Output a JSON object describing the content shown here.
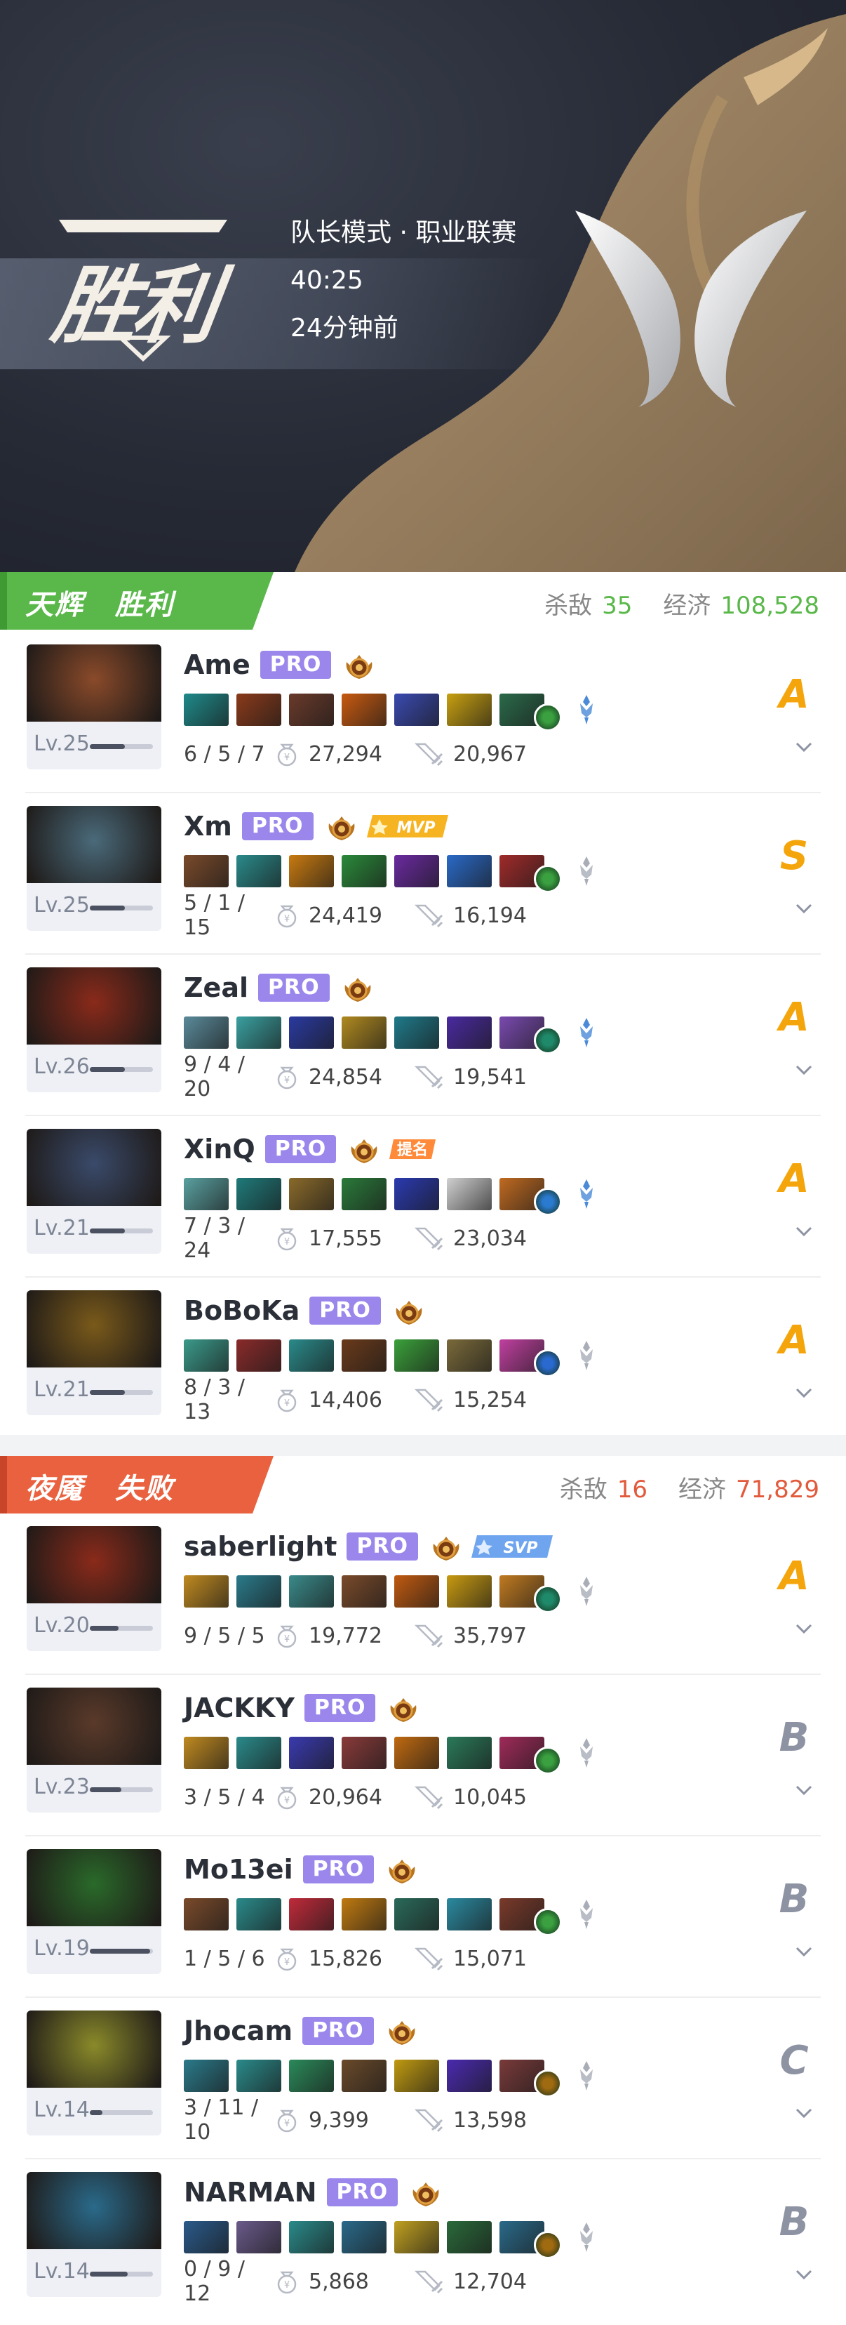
{
  "match": {
    "result": "胜利",
    "mode": "队长模式 · 职业联赛",
    "duration": "40:25",
    "time_ago": "24分钟前"
  },
  "teams": [
    {
      "side": "天辉",
      "result": "胜利",
      "kills_label": "杀敌",
      "kills": "35",
      "econ_label": "经济",
      "economy": "108,528",
      "color": "#5ab84a",
      "players": [
        {
          "name": "Ame",
          "pro": "PRO",
          "level": "Lv.25",
          "level_fill": 0.55,
          "kda": "6 / 5 / 7",
          "gold": "27,294",
          "damage": "20,967",
          "grade": "A",
          "badge": "",
          "hero_color": "#8a4a2a",
          "items": [
            "#1f8a8a",
            "#8a3a1a",
            "#6a3a2a",
            "#c85a10",
            "#3a4ab0",
            "#c8a010",
            "#2a6a4a"
          ],
          "neutral": "#3aa040"
        },
        {
          "name": "Xm",
          "pro": "PRO",
          "level": "Lv.25",
          "level_fill": 0.55,
          "kda": "5 / 1 / 15",
          "gold": "24,419",
          "damage": "16,194",
          "grade": "S",
          "badge": "MVP",
          "hero_color": "#4a6a7a",
          "items": [
            "#7a4a2a",
            "#2a8a8a",
            "#c87a10",
            "#2a8a3a",
            "#6a2aa0",
            "#2a6ac8",
            "#a02a2a"
          ],
          "neutral": "#3aa040"
        },
        {
          "name": "Zeal",
          "pro": "PRO",
          "level": "Lv.26",
          "level_fill": 0.55,
          "kda": "9 / 4 / 20",
          "gold": "24,854",
          "damage": "19,541",
          "grade": "A",
          "badge": "",
          "hero_color": "#8a2a1a",
          "items": [
            "#5a8a9a",
            "#3aa0a0",
            "#2a3aa0",
            "#b08a20",
            "#1f7a8a",
            "#4a2aa0",
            "#7a4ab0"
          ],
          "neutral": "#1f8a6a"
        },
        {
          "name": "XinQ",
          "pro": "PRO",
          "level": "Lv.21",
          "level_fill": 0.55,
          "kda": "7 / 3 / 24",
          "gold": "17,555",
          "damage": "23,034",
          "grade": "A",
          "badge": "提名",
          "hero_color": "#3a4a6a",
          "items": [
            "#5aa0a0",
            "#1f7a7a",
            "#8a6a2a",
            "#2a7a3a",
            "#2a3ab0",
            "#d0d0d0",
            "#c06a20"
          ],
          "neutral": "#2a7ad0"
        },
        {
          "name": "BoBoKa",
          "pro": "PRO",
          "level": "Lv.21",
          "level_fill": 0.55,
          "kda": "8 / 3 / 13",
          "gold": "14,406",
          "damage": "15,254",
          "grade": "A",
          "badge": "",
          "hero_color": "#7a5a1a",
          "items": [
            "#3a9a8a",
            "#8a2a2a",
            "#2a8a8a",
            "#6a3a1a",
            "#3aa03a",
            "#7a6a3a",
            "#c040a0"
          ],
          "neutral": "#2a6ad0"
        }
      ]
    },
    {
      "side": "夜魇",
      "result": "失败",
      "kills_label": "杀敌",
      "kills": "16",
      "econ_label": "经济",
      "economy": "71,829",
      "color": "#e25a3c",
      "players": [
        {
          "name": "saberlight",
          "pro": "PRO",
          "level": "Lv.20",
          "level_fill": 0.45,
          "kda": "9 / 5 / 5",
          "gold": "19,772",
          "damage": "35,797",
          "grade": "A",
          "badge": "SVP",
          "hero_color": "#8a2a1a",
          "items": [
            "#c08a20",
            "#2a7a8a",
            "#3a8a8a",
            "#7a4a2a",
            "#c05a10",
            "#c89a10",
            "#c07a20"
          ],
          "neutral": "#1f8a6a"
        },
        {
          "name": "JACKKY",
          "pro": "PRO",
          "level": "Lv.23",
          "level_fill": 0.5,
          "kda": "3 / 5 / 4",
          "gold": "20,964",
          "damage": "10,045",
          "grade": "B",
          "badge": "",
          "hero_color": "#5a3a2a",
          "items": [
            "#c08a20",
            "#2a8a8a",
            "#3a3ab0",
            "#8a3a3a",
            "#c06a10",
            "#2a7a5a",
            "#a02a5a"
          ],
          "neutral": "#3aa040"
        },
        {
          "name": "Mo13ei",
          "pro": "PRO",
          "level": "Lv.19",
          "level_fill": 0.95,
          "kda": "1 / 5 / 6",
          "gold": "15,826",
          "damage": "15,071",
          "grade": "B",
          "badge": "",
          "hero_color": "#2a6a2a",
          "items": [
            "#7a4a2a",
            "#2a8a8a",
            "#c02a3a",
            "#c07a10",
            "#2a6a5a",
            "#2a8aa0",
            "#7a3a2a"
          ],
          "neutral": "#3aa040"
        },
        {
          "name": "Jhocam",
          "pro": "PRO",
          "level": "Lv.14",
          "level_fill": 0.2,
          "kda": "3 / 11 / 10",
          "gold": "9,399",
          "damage": "13,598",
          "grade": "C",
          "badge": "",
          "hero_color": "#8a8a2a",
          "items": [
            "#2a7a8a",
            "#2a8a8a",
            "#2a8a5a",
            "#6a4a2a",
            "#c09a10",
            "#4a2ab0",
            "#7a3a3a"
          ],
          "neutral": "#a06a10"
        },
        {
          "name": "NARMAN",
          "pro": "PRO",
          "level": "Lv.14",
          "level_fill": 0.6,
          "kda": "0 / 9 / 12",
          "gold": "5,868",
          "damage": "12,704",
          "grade": "B",
          "badge": "",
          "hero_color": "#2a6a8a",
          "items": [
            "#2a5a8a",
            "#6a5a8a",
            "#2a8a8a",
            "#2a6a8a",
            "#c0a020",
            "#2a6a3a",
            "#2a6a8a"
          ],
          "neutral": "#a06a10"
        }
      ]
    }
  ]
}
